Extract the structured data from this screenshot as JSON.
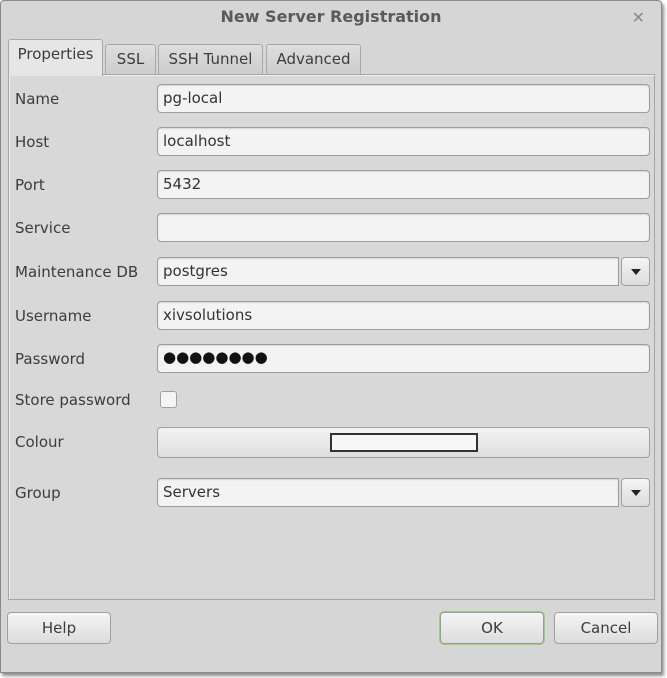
{
  "window": {
    "title": "New Server Registration",
    "close_icon": "close-x"
  },
  "tabs": [
    {
      "label": "Properties",
      "active": true
    },
    {
      "label": "SSL",
      "active": false
    },
    {
      "label": "SSH Tunnel",
      "active": false
    },
    {
      "label": "Advanced",
      "active": false
    }
  ],
  "form": {
    "name": {
      "label": "Name",
      "value": "pg-local"
    },
    "host": {
      "label": "Host",
      "value": "localhost"
    },
    "port": {
      "label": "Port",
      "value": "5432"
    },
    "service": {
      "label": "Service",
      "value": ""
    },
    "maintenance_db": {
      "label": "Maintenance DB",
      "value": "postgres"
    },
    "username": {
      "label": "Username",
      "value": "xivsolutions"
    },
    "password": {
      "label": "Password",
      "value": "●●●●●●●●"
    },
    "store_password": {
      "label": "Store password",
      "checked": false
    },
    "colour": {
      "label": "Colour",
      "swatch": "#f7f7f7"
    },
    "group": {
      "label": "Group",
      "value": "Servers"
    }
  },
  "buttons": {
    "help": "Help",
    "ok": "OK",
    "cancel": "Cancel"
  }
}
